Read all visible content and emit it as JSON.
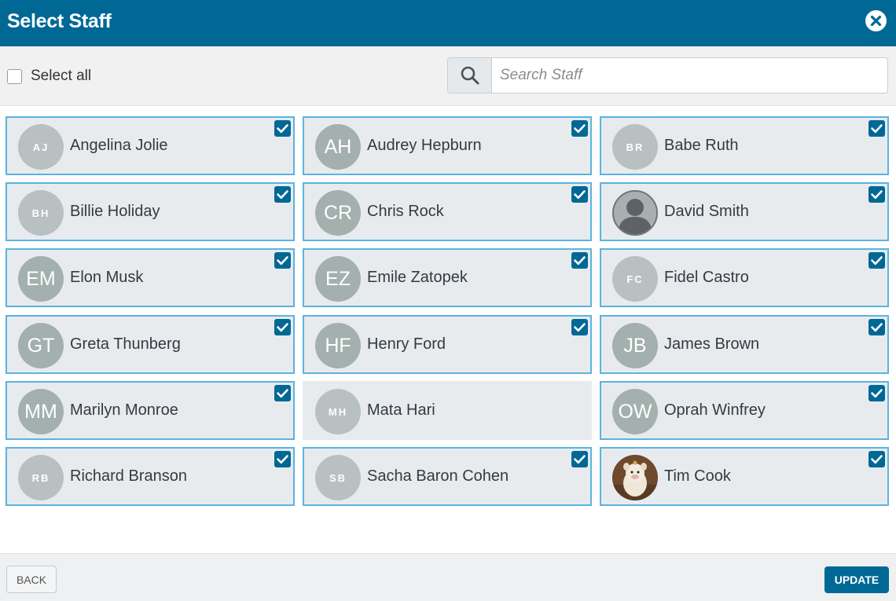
{
  "header": {
    "title": "Select Staff"
  },
  "toolbar": {
    "select_all_label": "Select all",
    "search_placeholder": "Search Staff",
    "search_value": ""
  },
  "staff": [
    {
      "name": "Angelina Jolie",
      "initials": "AJ",
      "avatar_style": "small",
      "selected": true
    },
    {
      "name": "Audrey Hepburn",
      "initials": "AH",
      "avatar_style": "large",
      "selected": true
    },
    {
      "name": "Babe Ruth",
      "initials": "BR",
      "avatar_style": "small",
      "selected": true
    },
    {
      "name": "Billie Holiday",
      "initials": "BH",
      "avatar_style": "small",
      "selected": true
    },
    {
      "name": "Chris Rock",
      "initials": "CR",
      "avatar_style": "large",
      "selected": true
    },
    {
      "name": "David Smith",
      "initials": "",
      "avatar_style": "person-photo",
      "selected": true
    },
    {
      "name": "Elon Musk",
      "initials": "EM",
      "avatar_style": "large",
      "selected": true
    },
    {
      "name": "Emile Zatopek",
      "initials": "EZ",
      "avatar_style": "large",
      "selected": true
    },
    {
      "name": "Fidel Castro",
      "initials": "FC",
      "avatar_style": "small",
      "selected": true
    },
    {
      "name": "Greta Thunberg",
      "initials": "GT",
      "avatar_style": "large",
      "selected": true
    },
    {
      "name": "Henry Ford",
      "initials": "HF",
      "avatar_style": "large",
      "selected": true
    },
    {
      "name": "James Brown",
      "initials": "JB",
      "avatar_style": "large",
      "selected": true
    },
    {
      "name": "Marilyn Monroe",
      "initials": "MM",
      "avatar_style": "large",
      "selected": true
    },
    {
      "name": "Mata Hari",
      "initials": "MH",
      "avatar_style": "small",
      "selected": false
    },
    {
      "name": "Oprah Winfrey",
      "initials": "OW",
      "avatar_style": "large",
      "selected": true
    },
    {
      "name": "Richard Branson",
      "initials": "RB",
      "avatar_style": "small",
      "selected": true
    },
    {
      "name": "Sacha Baron Cohen",
      "initials": "SB",
      "avatar_style": "small",
      "selected": true
    },
    {
      "name": "Tim Cook",
      "initials": "",
      "avatar_style": "toy-photo",
      "selected": true
    }
  ],
  "footer": {
    "back_label": "BACK",
    "update_label": "UPDATE"
  },
  "colors": {
    "header_bg": "#006895",
    "selected_border": "#5ab4df",
    "card_bg": "#e8ebee",
    "checkbox_checked": "#006895",
    "primary_button": "#006895"
  },
  "icons": {
    "close": "close-circle-icon",
    "search": "search-icon",
    "check": "checkmark-icon",
    "person": "person-silhouette-icon"
  }
}
